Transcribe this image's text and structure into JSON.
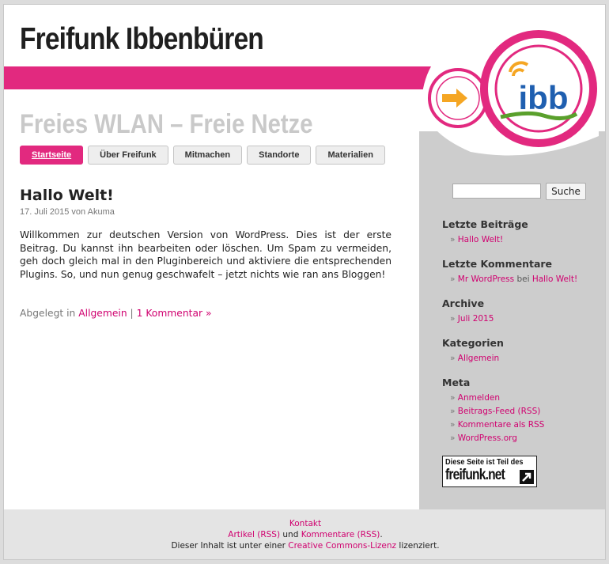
{
  "site": {
    "title": "Freifunk Ibbenbüren",
    "tagline": "Freies WLAN – Freie Netze",
    "logo_text": "ibb",
    "accent_color": "#e2297f",
    "logo_arrow_color": "#f5a623"
  },
  "nav": {
    "items": [
      "Startseite",
      "Über Freifunk",
      "Mitmachen",
      "Standorte",
      "Materialien"
    ],
    "active": "Startseite"
  },
  "post": {
    "title": "Hallo Welt!",
    "meta": "17. Juli 2015 von Akuma",
    "body": "Willkommen zur deutschen Version von WordPress. Dies ist der erste Beitrag. Du kannst ihn bearbeiten oder löschen. Um Spam zu vermeiden, geh doch gleich mal in den Pluginbereich und aktiviere die entsprechenden Plugins. So, und nun genug geschwafelt – jetzt nichts wie ran ans Bloggen!",
    "filed_prefix": "Abgelegt in",
    "category": "Allgemein",
    "separator": "|",
    "comments": "1 Kommentar »"
  },
  "search": {
    "value": "",
    "button": "Suche"
  },
  "sidebar": {
    "recent_posts": {
      "title": "Letzte Beiträge",
      "items": [
        "Hallo Welt!"
      ]
    },
    "recent_comments": {
      "title": "Letzte Kommentare",
      "author": "Mr WordPress",
      "connector": "bei",
      "post": "Hallo Welt!"
    },
    "archive": {
      "title": "Archive",
      "items": [
        "Juli 2015"
      ]
    },
    "categories": {
      "title": "Kategorien",
      "items": [
        "Allgemein"
      ]
    },
    "meta": {
      "title": "Meta",
      "items": [
        "Anmelden",
        "Beitrags-Feed (RSS)",
        "Kommentare als RSS",
        "WordPress.org"
      ]
    },
    "badge": {
      "top": "Diese Seite ist Teil des",
      "main": "freifunk.net"
    }
  },
  "footer": {
    "contact": "Kontakt",
    "articles_rss": "Artikel (RSS)",
    "and": "und",
    "comments_rss": "Kommentare (RSS)",
    "period": ".",
    "license_prefix": "Dieser Inhalt ist unter einer",
    "license_link": "Creative Commons-Lizenz",
    "license_suffix": "lizenziert."
  }
}
